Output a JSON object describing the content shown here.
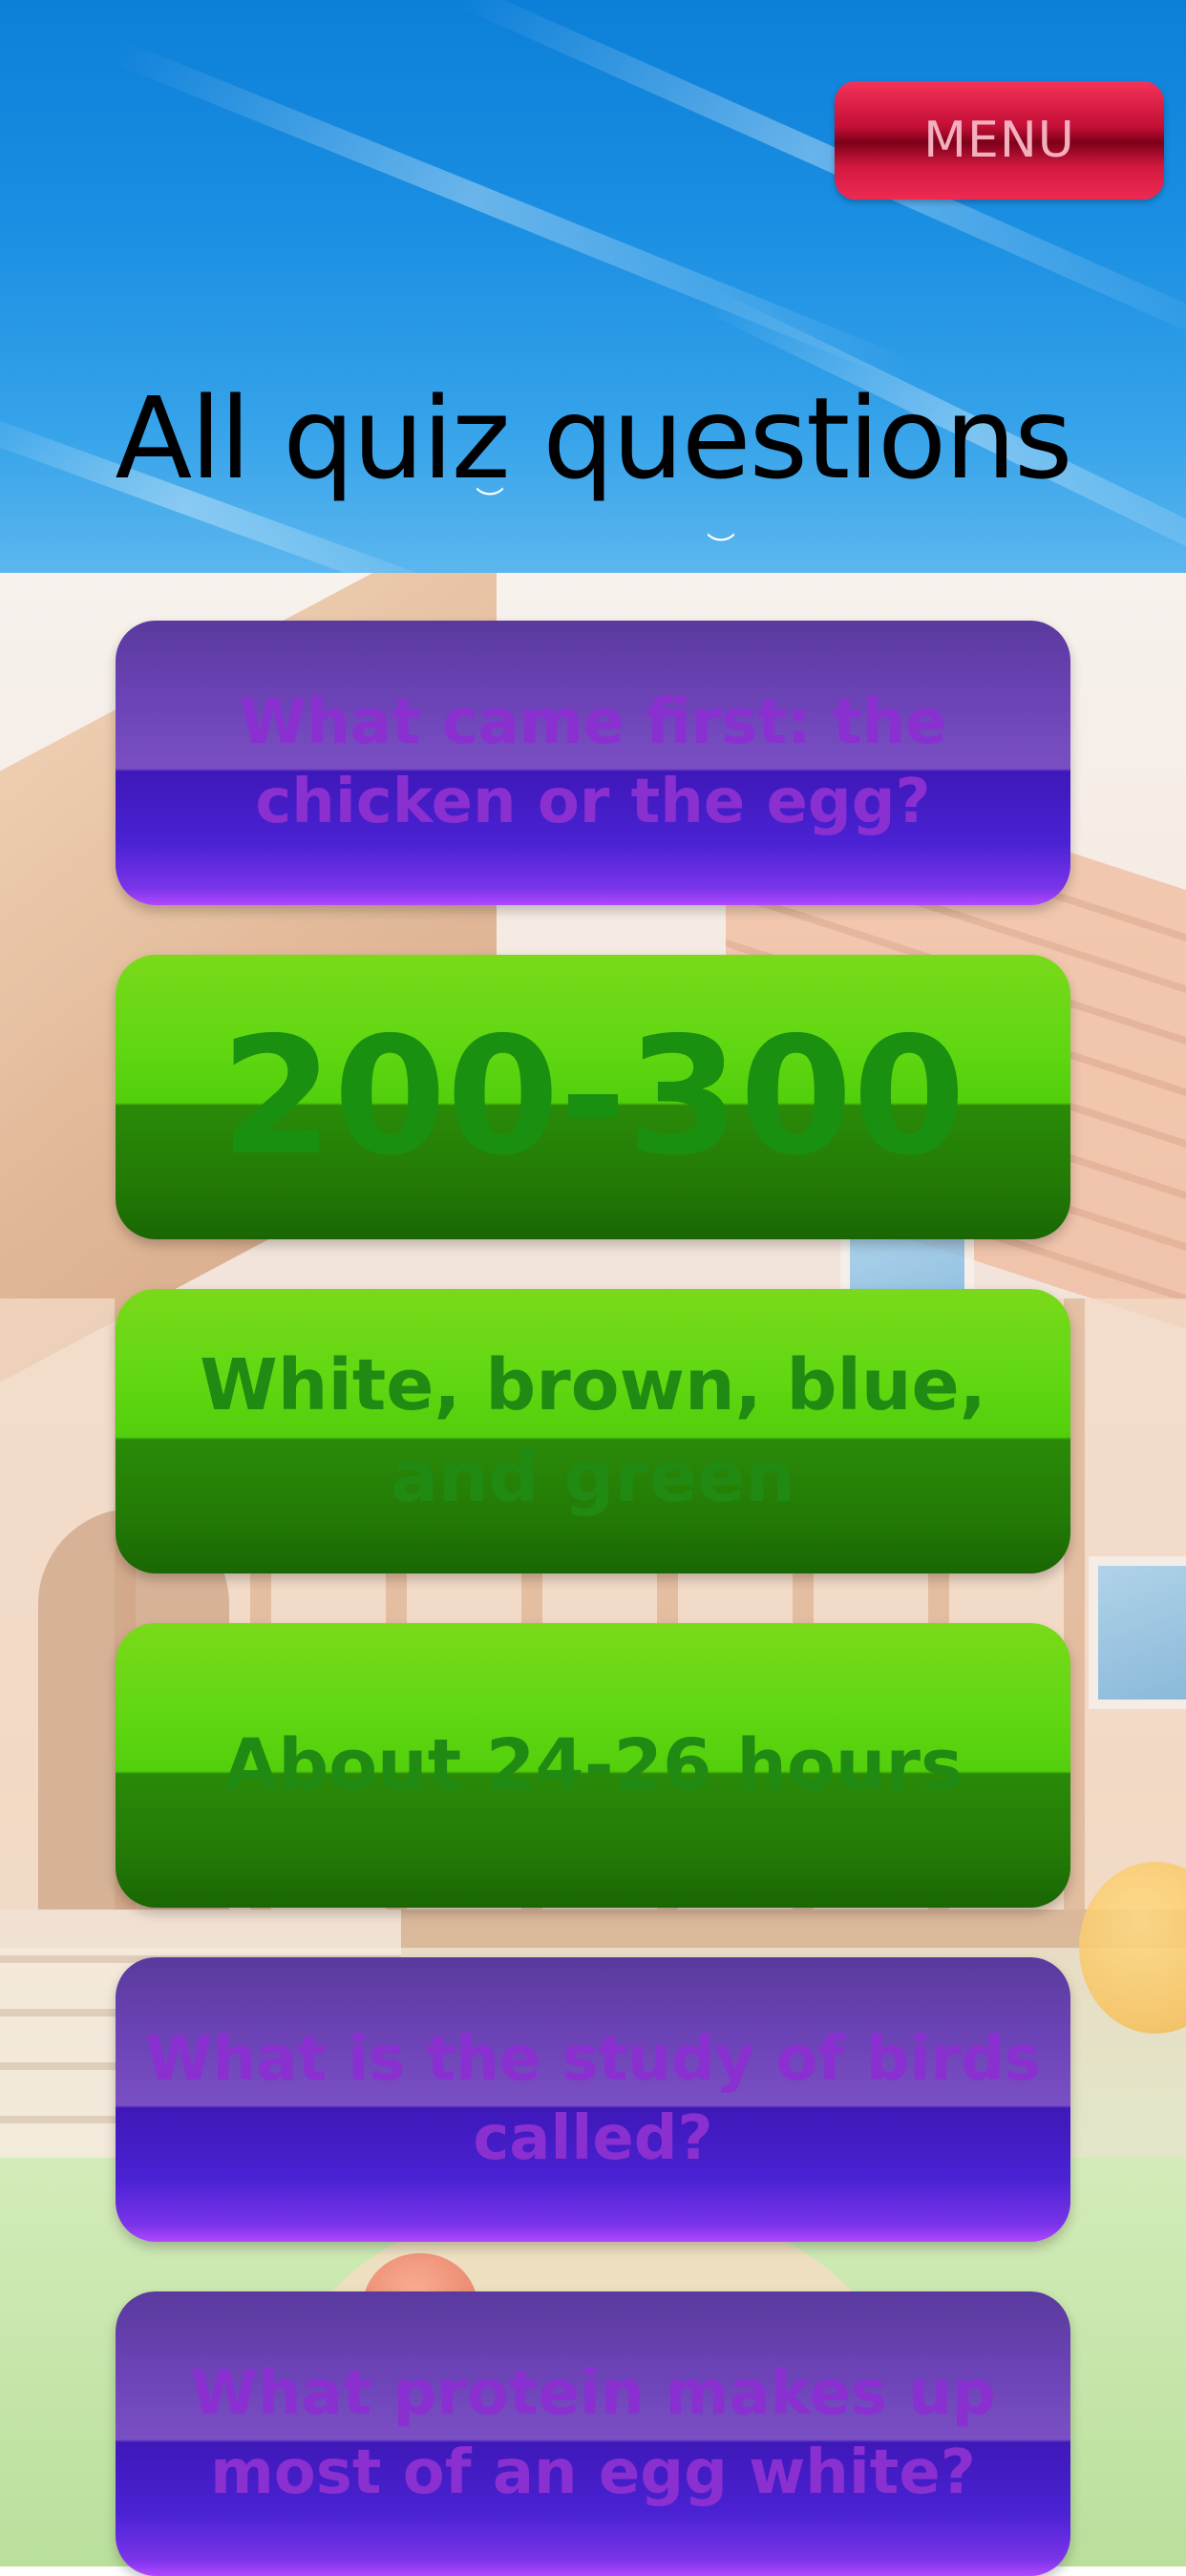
{
  "header": {
    "menu_label": "MENU",
    "page_title": "All quiz questions"
  },
  "colors": {
    "sky": "#1b8fe2",
    "menu_button": "#c40f36",
    "question_button": "#5a3a9e",
    "answer_button": "#52cf0c",
    "question_text": "#8a2fd0",
    "answer_text": "#1c8a0e"
  },
  "quiz_items": [
    {
      "type": "question",
      "text": "What came first: the chicken or the egg?"
    },
    {
      "type": "answer",
      "text": "200-300"
    },
    {
      "type": "answer",
      "text": "White, brown, blue, and green"
    },
    {
      "type": "answer",
      "text": "About 24-26 hours"
    },
    {
      "type": "question",
      "text": "What is the study of birds called?"
    },
    {
      "type": "question",
      "text": "What protein makes up most of an egg white?"
    }
  ]
}
